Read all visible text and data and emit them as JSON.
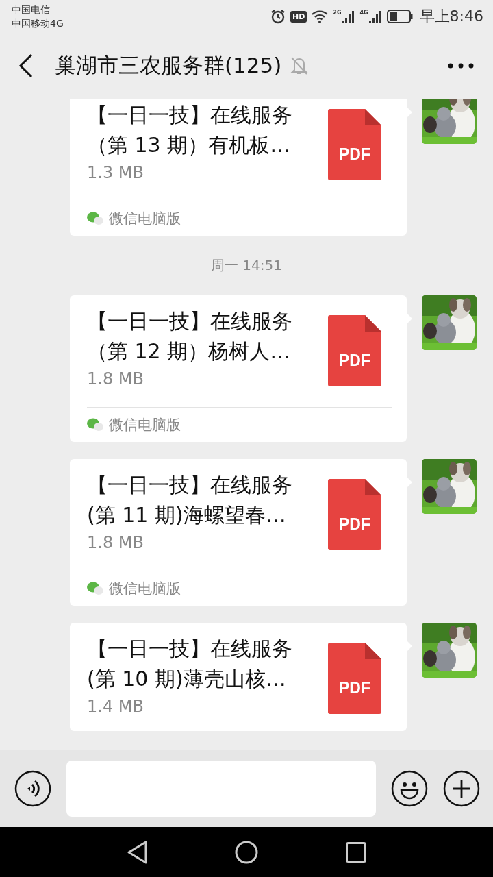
{
  "status_bar": {
    "carriers": [
      "中国电信",
      "中国移动4G"
    ],
    "hd_badge": "HD",
    "signals": [
      "2G",
      "4G"
    ],
    "time": "早上8:46"
  },
  "header": {
    "title": "巢湖市三农服务群(125)",
    "muted": true
  },
  "messages": [
    {
      "kind": "file",
      "lines": [
        "【一日一技】在线服务",
        "（第 13 期）有机板…"
      ],
      "file_type": "PDF",
      "size": "1.3 MB",
      "source": "微信电脑版"
    },
    {
      "kind": "time",
      "text": "周一 14:51"
    },
    {
      "kind": "file",
      "lines": [
        "【一日一技】在线服务",
        "（第 12 期）杨树人…"
      ],
      "file_type": "PDF",
      "size": "1.8 MB",
      "source": "微信电脑版"
    },
    {
      "kind": "file",
      "lines": [
        "【一日一技】在线服务",
        "(第 11 期)海螺望春…"
      ],
      "file_type": "PDF",
      "size": "1.8 MB",
      "source": "微信电脑版"
    },
    {
      "kind": "file",
      "lines": [
        "【一日一技】在线服务",
        "(第 10 期)薄壳山核…"
      ],
      "file_type": "PDF",
      "size": "1.4 MB"
    }
  ]
}
